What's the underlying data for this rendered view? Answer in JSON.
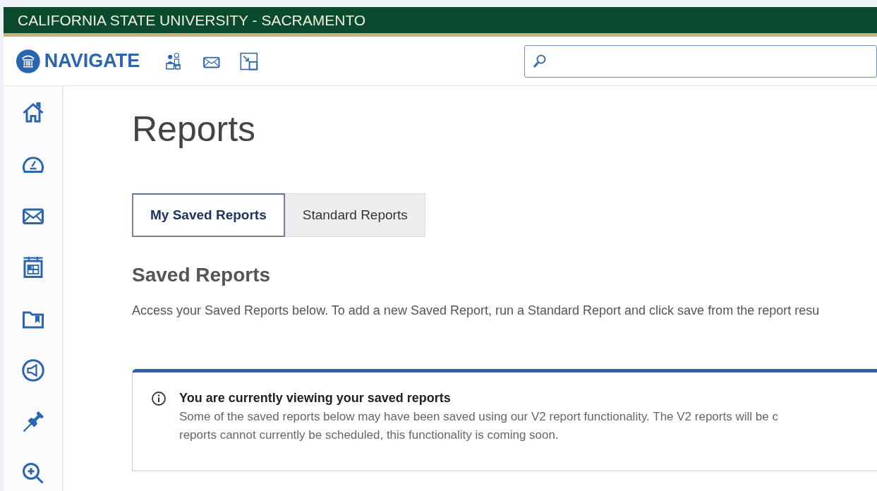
{
  "banner": {
    "title": "CALIFORNIA STATE UNIVERSITY - SACRAMENTO"
  },
  "nav": {
    "brand": "NAVIGATE"
  },
  "page": {
    "title": "Reports"
  },
  "tabs": [
    {
      "label": "My Saved Reports",
      "selected": true
    },
    {
      "label": "Standard Reports",
      "selected": false
    }
  ],
  "section": {
    "title": "Saved Reports",
    "description": "Access your Saved Reports below. To add a new Saved Report, run a Standard Report and click save from the report resu"
  },
  "notice": {
    "title": "You are currently viewing your saved reports",
    "lines": [
      "Some of the saved reports below may have been saved using our V2 report functionality. The V2 reports will be c",
      "reports cannot currently be scheduled, this functionality is coming soon."
    ]
  }
}
